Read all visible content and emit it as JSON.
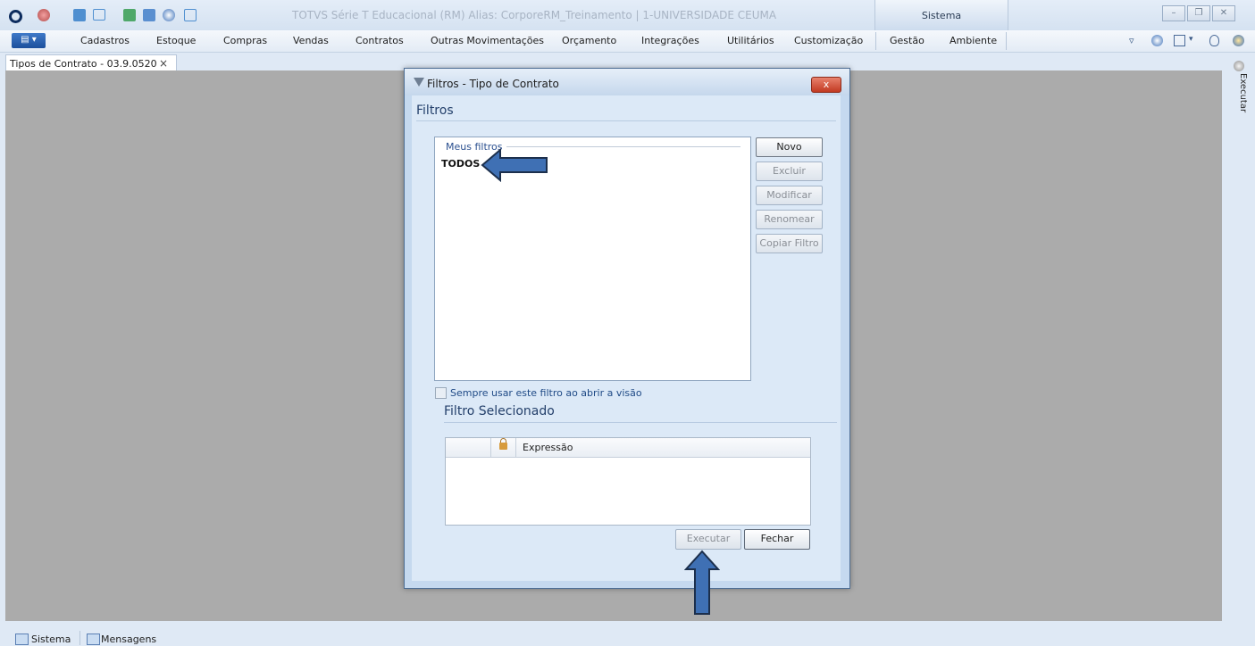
{
  "window": {
    "title": "TOTVS Série T Educacional (RM) Alias: CorporeRM_Treinamento | 1-UNIVERSIDADE CEUMA",
    "context_tab": "Sistema"
  },
  "menu": {
    "items": [
      "Cadastros",
      "Estoque",
      "Compras",
      "Vendas",
      "Contratos",
      "Outras Movimentações",
      "Orçamento",
      "Integrações",
      "Utilitários",
      "Customização",
      "Gestão",
      "Ambiente"
    ]
  },
  "document_tab": {
    "label": "Tipos de Contrato - 03.9.0520",
    "close": "×"
  },
  "side_panel": {
    "executar_label": "Executar"
  },
  "dialog": {
    "title": "Filtros - Tipo de Contrato",
    "close_glyph": "x",
    "filters_heading": "Filtros",
    "my_filters_legend": "Meus filtros",
    "my_filters_items": [
      "TODOS"
    ],
    "buttons": {
      "novo": "Novo",
      "excluir": "Excluir",
      "modificar": "Modificar",
      "renomear": "Renomear",
      "copiar_filtro": "Copiar Filtro",
      "executar": "Executar",
      "fechar": "Fechar"
    },
    "always_use_checkbox": {
      "label": "Sempre usar este filtro ao abrir a visão",
      "checked": false
    },
    "selected_filter_heading": "Filtro Selecionado",
    "expression_grid": {
      "column_header": "Expressão",
      "rows": []
    }
  },
  "statusbar": {
    "items": [
      "Sistema",
      "Mensagens"
    ]
  },
  "colors": {
    "accent": "#1c4f9c",
    "workspace": "#ababab",
    "dialog_bg": "#dce9f7",
    "annotation_arrow": "#3f70b4"
  }
}
